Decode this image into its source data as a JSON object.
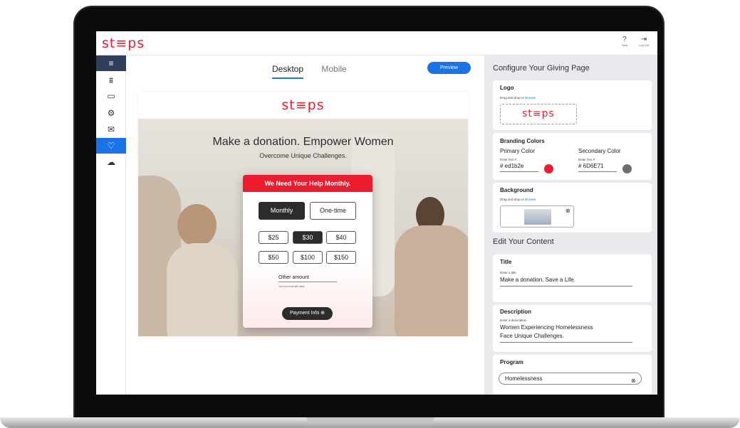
{
  "app": {
    "logo_text": "st≡ps"
  },
  "topbar": {
    "help_label": "Help",
    "logout_label": "Log Out"
  },
  "sidebar": {
    "items": [
      "menu",
      "analytics",
      "payments",
      "settings",
      "messages",
      "giving-page",
      "salesforce"
    ]
  },
  "editor": {
    "tabs": [
      "Desktop",
      "Mobile"
    ],
    "preview_label": "Preview"
  },
  "preview": {
    "logo_text": "st≡ps",
    "hero_title": "Make a donation. Empower Women",
    "hero_subtitle": "Overcome Unique Challenges.",
    "card_header": "We Need Your Help Monthly.",
    "frequency": [
      "Monthly",
      "One-time"
    ],
    "amounts": [
      "$25",
      "$30",
      "$40",
      "$50",
      "$100",
      "$150"
    ],
    "selected_amount": "$30",
    "other_amount_label": "Other amount",
    "other_amount_help": "Your personal gift value",
    "payment_button": "Payment Info ⊕"
  },
  "config": {
    "title": "Configure Your Giving Page",
    "logo": {
      "label": "Logo",
      "drag_text": "Drag and drop or ",
      "browse": "Browse",
      "logo_text": "st≡ps"
    },
    "branding": {
      "label": "Branding Colors",
      "primary_label": "Primary Color",
      "secondary_label": "Secondary Color",
      "hex_hint": "Enter hex #",
      "primary_value": "# ed1b2e",
      "secondary_value": "# 6D6E71",
      "primary_color": "#ed1b2e",
      "secondary_color": "#6D6E71"
    },
    "background": {
      "label": "Background",
      "drag_text": "Drag and drop or ",
      "browse": "Browse"
    },
    "content_title": "Edit Your Content",
    "title_field": {
      "label": "Title",
      "hint": "Enter a title",
      "value": "Make a donation. Save a Life."
    },
    "description_field": {
      "label": "Description",
      "hint": "Enter a description",
      "line1": "Women Experiencing Homelessness",
      "line2": "Face Unique Challenges."
    },
    "program_field": {
      "label": "Program",
      "value": "Homelessness"
    }
  }
}
